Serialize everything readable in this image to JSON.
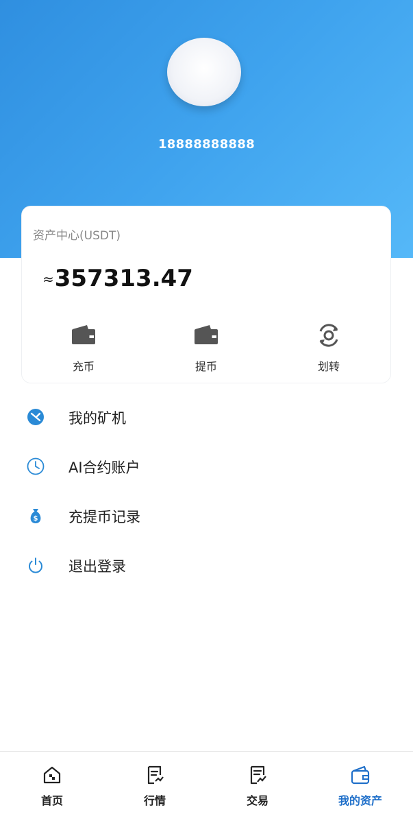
{
  "colors": {
    "header_start": "#2f8fe0",
    "header_end": "#55b8f8",
    "accent": "#1f6fc9",
    "menu_icon": "#2a8ad6"
  },
  "profile": {
    "phone": "18888888888"
  },
  "assets": {
    "title": "资产中心(USDT)",
    "approx": "≈",
    "amount": "357313.47",
    "actions": [
      {
        "label": "充币",
        "icon": "wallet-icon"
      },
      {
        "label": "提币",
        "icon": "wallet-icon"
      },
      {
        "label": "划转",
        "icon": "transfer-icon"
      }
    ]
  },
  "menu": [
    {
      "label": "我的矿机",
      "icon": "mining-icon"
    },
    {
      "label": "AI合约账户",
      "icon": "clock-icon"
    },
    {
      "label": "充提币记录",
      "icon": "money-bag-icon"
    },
    {
      "label": "退出登录",
      "icon": "power-icon"
    }
  ],
  "nav": [
    {
      "label": "首页",
      "icon": "home-icon"
    },
    {
      "label": "行情",
      "icon": "market-icon"
    },
    {
      "label": "交易",
      "icon": "trade-icon"
    },
    {
      "label": "我的资产",
      "icon": "wallet-icon",
      "active": true
    }
  ]
}
